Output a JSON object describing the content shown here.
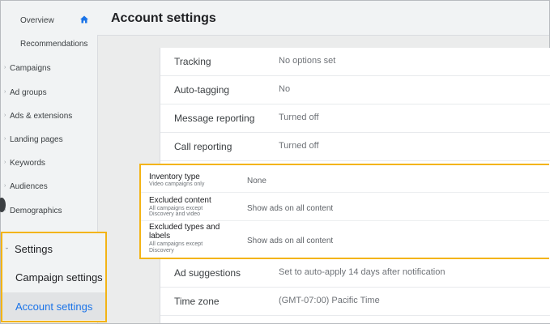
{
  "sidebar": {
    "overview": "Overview",
    "recommendations": "Recommendations",
    "items": [
      {
        "label": "Campaigns"
      },
      {
        "label": "Ad groups"
      },
      {
        "label": "Ads & extensions"
      },
      {
        "label": "Landing pages"
      },
      {
        "label": "Keywords"
      },
      {
        "label": "Audiences"
      },
      {
        "label": "Demographics"
      }
    ],
    "settings": {
      "label": "Settings",
      "campaign_settings": "Campaign settings",
      "account_settings": "Account settings"
    },
    "chevron": "›",
    "colors": {
      "active": "#1a73e8",
      "highlight": "#f3b415"
    }
  },
  "header": {
    "title": "Account settings"
  },
  "settings": {
    "tracking": {
      "name": "Tracking",
      "value": "No options set"
    },
    "auto_tagging": {
      "name": "Auto-tagging",
      "value": "No"
    },
    "message_reporting": {
      "name": "Message reporting",
      "value": "Turned off"
    },
    "call_reporting": {
      "name": "Call reporting",
      "value": "Turned off"
    },
    "inventory_type": {
      "name": "Inventory type",
      "sub": "Video campaigns only",
      "value": "None"
    },
    "excluded_content": {
      "name": "Excluded content",
      "sub1": "All campaigns except",
      "sub2": "Discovery and video",
      "value": "Show ads on all content"
    },
    "excluded_types": {
      "name1": "Excluded types and",
      "name2": "labels",
      "sub1": "All campaigns except",
      "sub2": "Discovery",
      "value": "Show ads on all content"
    },
    "ad_suggestions": {
      "name": "Ad suggestions",
      "value": "Set to auto-apply 14 days after notification"
    },
    "time_zone": {
      "name": "Time zone",
      "value": "(GMT-07:00) Pacific Time"
    }
  }
}
